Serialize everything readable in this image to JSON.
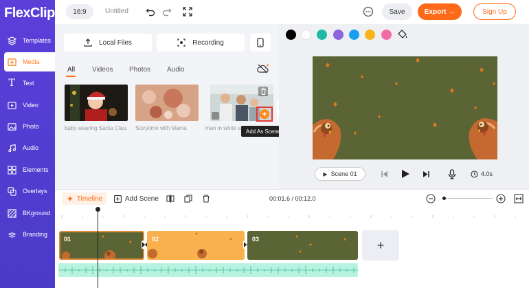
{
  "app": {
    "logo": "FlexClip"
  },
  "sidebar": {
    "items": [
      {
        "label": "Templates"
      },
      {
        "label": "Media"
      },
      {
        "label": "Text"
      },
      {
        "label": "Video"
      },
      {
        "label": "Photo"
      },
      {
        "label": "Audio"
      },
      {
        "label": "Elements"
      },
      {
        "label": "Overlays"
      },
      {
        "label": "BKground"
      },
      {
        "label": "Branding"
      }
    ]
  },
  "topbar": {
    "ratio": "16:9",
    "title": "Untitled",
    "save": "Save",
    "export": "Export →",
    "signup": "Sign Up"
  },
  "media": {
    "local_files": "Local Files",
    "recording": "Recording",
    "tabs": [
      "All",
      "Videos",
      "Photos",
      "Audio"
    ],
    "thumbs": [
      {
        "caption": "baby wearing Santa Clau..."
      },
      {
        "caption": "Storytime with Mama"
      },
      {
        "caption": "man in white s..."
      }
    ],
    "tooltip": "Add As Scene"
  },
  "preview": {
    "colors": [
      "#000000",
      "#ffffff",
      "#1fb8a4",
      "#8b64e0",
      "#1a9ef0",
      "#f7b51a",
      "#f26aa6"
    ],
    "scene_label": "Scene 01",
    "duration": "4.0s"
  },
  "timeline": {
    "tab": "Timeline",
    "add_scene": "Add Scene",
    "time": "00:01.6 / 00:12.0",
    "clips": [
      {
        "num": "01"
      },
      {
        "num": "02"
      },
      {
        "num": "03"
      }
    ],
    "add": "+"
  }
}
